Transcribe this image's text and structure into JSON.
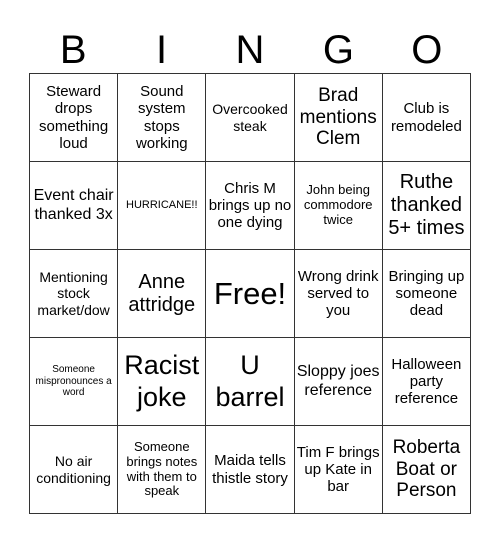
{
  "header": {
    "letters": [
      "B",
      "I",
      "N",
      "G",
      "O"
    ]
  },
  "cells": [
    [
      "Steward drops something loud",
      "Sound system stops working",
      "Overcooked steak",
      "Brad mentions Clem",
      "Club is remodeled"
    ],
    [
      "Event chair thanked 3x",
      "HURRICANE!!",
      "Chris M brings up no one dying",
      "John being commodore twice",
      "Ruthe thanked 5+ times"
    ],
    [
      "Mentioning stock market/dow",
      "Anne attridge",
      "Free!",
      "Wrong drink served to you",
      "Bringing up someone dead"
    ],
    [
      "Someone mispronounces a word",
      "Racist joke",
      "U barrel",
      "Sloppy joes reference",
      "Halloween party reference"
    ],
    [
      "No air conditioning",
      "Someone brings notes with them to speak",
      "Maida tells thistle story",
      "Tim F brings up Kate in bar",
      "Roberta Boat or Person"
    ]
  ],
  "free_space": {
    "label": "Free!"
  }
}
